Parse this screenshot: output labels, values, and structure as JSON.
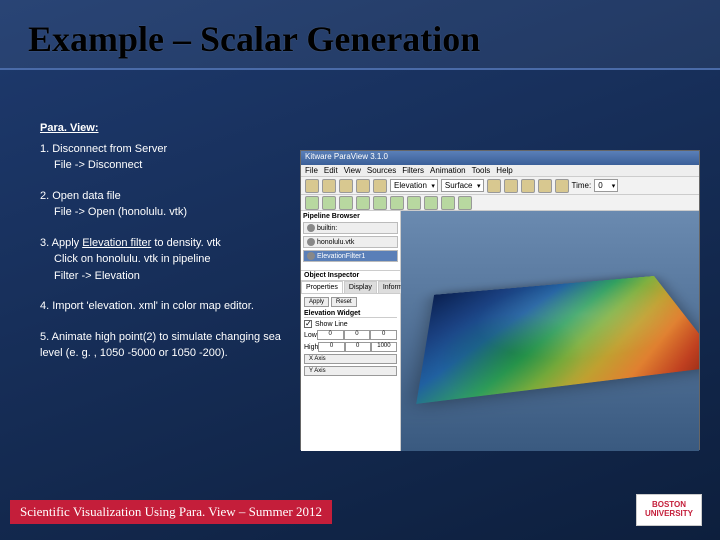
{
  "slide": {
    "title": "Example – Scalar Generation"
  },
  "instructions": {
    "heading": "Para. View:",
    "step1": {
      "text": "1. Disconnect from Server",
      "sub": "File -> Disconnect"
    },
    "step2": {
      "text": "2. Open data file",
      "sub": "File -> Open (honolulu. vtk)"
    },
    "step3": {
      "text_pre": "3. Apply ",
      "filter": "Elevation filter",
      "text_post": " to density. vtk",
      "sub1": "Click on honolulu. vtk in pipeline",
      "sub2": "Filter -> Elevation"
    },
    "step4": {
      "text": "4. Import 'elevation. xml' in color map editor."
    },
    "step5": {
      "text": "5. Animate high point(2) to simulate changing sea level (e. g. , 1050 -5000 or 1050 -200)."
    }
  },
  "paraview": {
    "titlebar": "Kitware ParaView 3.1.0",
    "menu": [
      "File",
      "Edit",
      "View",
      "Sources",
      "Filters",
      "Animation",
      "Tools",
      "Help"
    ],
    "dropdown_filter": "Elevation",
    "dropdown_repr": "Surface",
    "time_label": "Time:",
    "time_value": "0",
    "pipeline_header": "Pipeline Browser",
    "pipeline": {
      "server": "builtin:",
      "item1": "honolulu.vtk",
      "item2": "ElevationFilter1"
    },
    "inspector": {
      "header": "Object Inspector",
      "tabs": [
        "Properties",
        "Display",
        "Information"
      ],
      "section": "Elevation Widget",
      "show_line": "Show Line",
      "low": "Low",
      "low_vals": [
        "0",
        "0",
        "0"
      ],
      "high": "High",
      "high_vals": [
        "0",
        "0",
        "1000"
      ],
      "xaxis": "X Axis",
      "yaxis": "Y Axis",
      "apply": "Apply",
      "reset": "Reset"
    }
  },
  "footer": {
    "text": "Scientific Visualization Using Para. View – Summer 2012",
    "logo_line1": "BOSTON",
    "logo_line2": "UNIVERSITY"
  }
}
